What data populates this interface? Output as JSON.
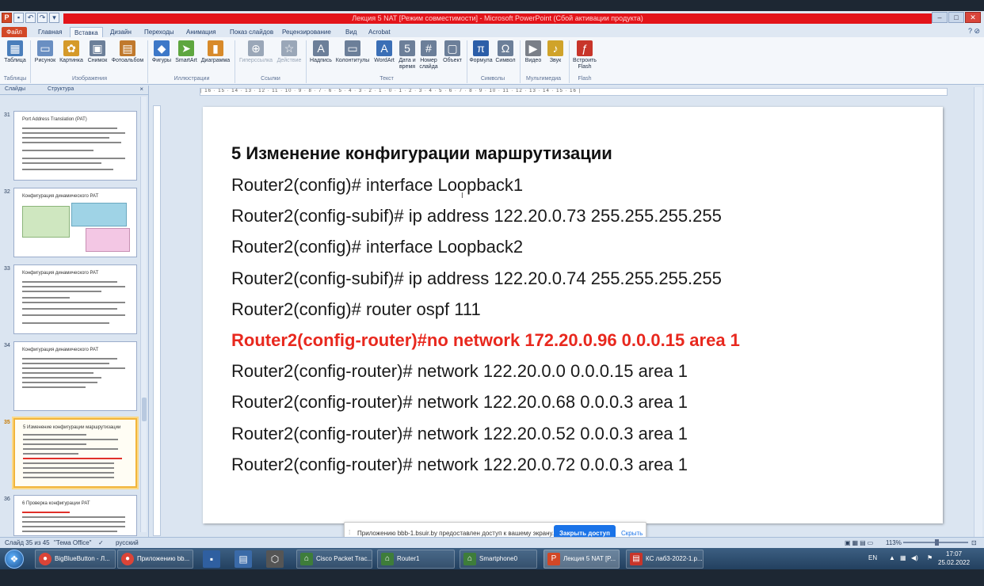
{
  "window": {
    "title": "Лекция 5 NAT [Режим совместимости] - Microsoft PowerPoint (Сбой активации продукта)",
    "controls": [
      "–",
      "□",
      "✕"
    ]
  },
  "tabs": {
    "file": "Файл",
    "items": [
      "Главная",
      "Вставка",
      "Дизайн",
      "Переходы",
      "Анимация",
      "Показ слайдов",
      "Рецензирование",
      "Вид",
      "Acrobat"
    ],
    "active": "Вставка"
  },
  "ribbon": {
    "buttons": [
      {
        "label": "Таблица",
        "icon": "table-icon",
        "color": "#4a7ebb"
      },
      {
        "label": "Рисунок",
        "icon": "picture-icon",
        "color": "#6a8fc2"
      },
      {
        "label": "Картинка",
        "icon": "clipart-icon",
        "color": "#d59a2a"
      },
      {
        "label": "Снимок",
        "icon": "screenshot-icon",
        "color": "#6c7f99"
      },
      {
        "label": "Фотоальбом",
        "icon": "photo-album-icon",
        "color": "#c0792d"
      },
      {
        "label": "Фигуры",
        "icon": "shapes-icon",
        "color": "#3d78c8"
      },
      {
        "label": "SmartArt",
        "icon": "smartart-icon",
        "color": "#5ea63f"
      },
      {
        "label": "Диаграмма",
        "icon": "chart-icon",
        "color": "#d88a2a"
      },
      {
        "label": "Гиперссылка",
        "icon": "hyperlink-icon",
        "color": "#9aa7b8"
      },
      {
        "label": "Действие",
        "icon": "action-icon",
        "color": "#9aa7b8"
      },
      {
        "label": "Надпись",
        "icon": "textbox-icon",
        "color": "#6c7f99"
      },
      {
        "label": "Колонтитулы",
        "icon": "header-footer-icon",
        "color": "#6c7f99"
      },
      {
        "label": "WordArt",
        "icon": "wordart-icon",
        "color": "#3b6fb6"
      },
      {
        "label": "Дата и время",
        "icon": "date-time-icon",
        "color": "#6c7f99"
      },
      {
        "label": "Номер слайда",
        "icon": "slide-number-icon",
        "color": "#6c7f99"
      },
      {
        "label": "Объект",
        "icon": "object-icon",
        "color": "#6c7f99"
      },
      {
        "label": "Формула",
        "icon": "equation-icon",
        "color": "#2c5ea8"
      },
      {
        "label": "Символ",
        "icon": "symbol-icon",
        "color": "#6c7f99"
      },
      {
        "label": "Видео",
        "icon": "video-icon",
        "color": "#7a7f88"
      },
      {
        "label": "Звук",
        "icon": "audio-icon",
        "color": "#d0a32a"
      },
      {
        "label": "Встроить Flash",
        "icon": "flash-icon",
        "color": "#c8352a"
      }
    ],
    "groups": [
      "Таблицы",
      "Изображения",
      "Иллюстрации",
      "Ссылки",
      "Текст",
      "Символы",
      "Мультимедиа",
      "Flash"
    ]
  },
  "left_panel": {
    "tab_slides": "Слайды",
    "tab_outline": "Структура",
    "close": "×",
    "thumbnails": [
      {
        "number": "31",
        "title": "Port Address Translation (PAT)",
        "selected": false
      },
      {
        "number": "32",
        "title": "Конфигурация динамического PAT",
        "selected": false
      },
      {
        "number": "33",
        "title": "Конфигурация динамического PAT",
        "selected": false
      },
      {
        "number": "34",
        "title": "Конфигурация динамического PAT",
        "selected": false
      },
      {
        "number": "35",
        "title": "5 Изменение конфигурации маршрутизации",
        "selected": true
      },
      {
        "number": "36",
        "title": "6 Проверка конфигурации PAT",
        "selected": false
      }
    ]
  },
  "ruler": {
    "text": "| 16 · 15 · 14 · 13 · 12 · 11 · 10 · 9 · 8 · 7 · 6 · 5 · 4 · 3 · 2 · 1 · 0 · 1 · 2 · 3 · 4 · 5 · 6 · 7 · 8 · 9 · 10 · 11 · 12 · 13 · 14 · 15 · 16 |"
  },
  "slide": {
    "title": "5 Изменение конфигурации маршрутизации",
    "lines": [
      {
        "text": "Router2(config)# interface Loopback1",
        "highlight": false
      },
      {
        "text": "Router2(config-subif)# ip address 122.20.0.73 255.255.255.255",
        "highlight": false
      },
      {
        "text": "Router2(config)# interface Loopback2",
        "highlight": false
      },
      {
        "text": "Router2(config-subif)# ip address 122.20.0.74 255.255.255.255",
        "highlight": false
      },
      {
        "text": "Router2(config)# router ospf 111",
        "highlight": false
      },
      {
        "text": "Router2(config-router)#no network 172.20.0.96  0.0.0.15  area 1",
        "highlight": true
      },
      {
        "text": "Router2(config-router)# network 122.20.0.0 0.0.0.15 area 1",
        "highlight": false
      },
      {
        "text": "Router2(config-router)# network 122.20.0.68  0.0.0.3 area 1",
        "highlight": false
      },
      {
        "text": "Router2(config-router)# network 122.20.0.52  0.0.0.3 area 1",
        "highlight": false
      },
      {
        "text": "Router2(config-router)# network 122.20.0.72  0.0.0.3 area 1",
        "highlight": false
      }
    ],
    "highlight_color": "#e8281e"
  },
  "notification": {
    "message": "Приложению bbb-1.bsuir.by предоставлен доступ к вашему экрану.",
    "stop_button": "Закрыть доступ",
    "hide_link": "Скрыть"
  },
  "statusbar": {
    "slide_info": "Слайд 35 из 45",
    "theme": "\"Тема Office\"",
    "language": "русский",
    "zoom": "113%"
  },
  "taskbar": {
    "tasks": [
      {
        "label": "BigBlueButton - Л...",
        "icon": "chrome-icon",
        "active": false
      },
      {
        "label": "Приложению bb...",
        "icon": "chrome-icon",
        "active": false
      },
      {
        "label": "Cisco Packet Trac...",
        "icon": "packet-tracer-icon",
        "active": false
      },
      {
        "label": "Router1",
        "icon": "packet-tracer-icon",
        "active": false
      },
      {
        "label": "Smartphone0",
        "icon": "packet-tracer-icon",
        "active": false
      },
      {
        "label": "Лекция 5 NAT [P...",
        "icon": "powerpoint-icon",
        "active": true
      },
      {
        "label": "КС лаб3-2022-1.р...",
        "icon": "pdf-icon",
        "active": false
      }
    ],
    "lang": "EN",
    "time": "17:07",
    "date": "25.02.2022"
  }
}
